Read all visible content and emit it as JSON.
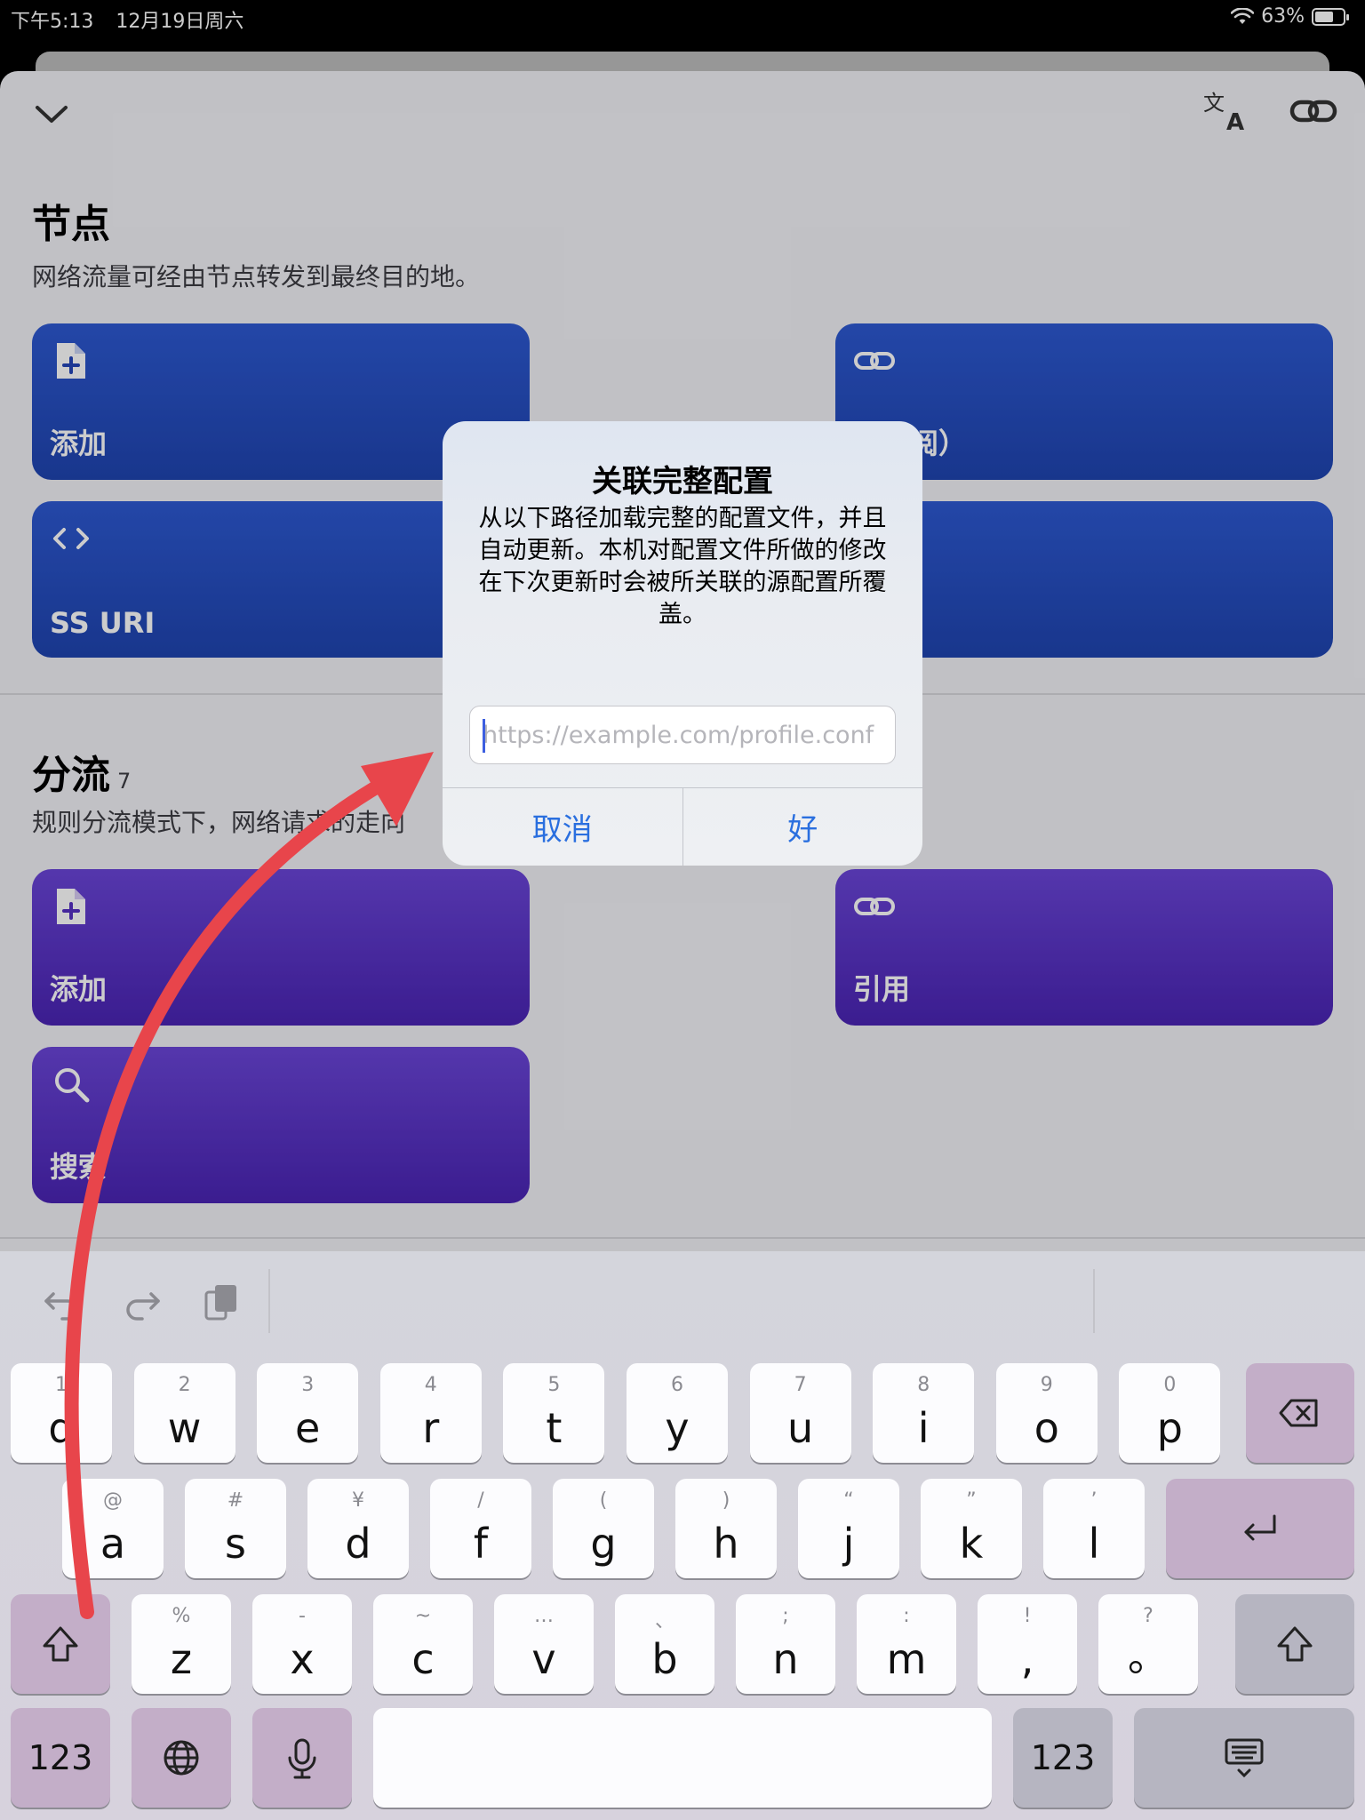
{
  "status_bar": {
    "time": "下午5:13",
    "date": "12月19日周六",
    "battery": "63%"
  },
  "nodes": {
    "title": "节点",
    "subtitle": "网络流量可经由节点转发到最终目的地。",
    "cards": [
      {
        "label": "添加",
        "icon": "file-plus-icon"
      },
      {
        "label": "（订阅）",
        "icon": "link-icon"
      },
      {
        "label": "SS URI",
        "icon": "code-icon"
      }
    ]
  },
  "rules": {
    "title": "分流",
    "count": "7",
    "subtitle": "规则分流模式下，网络请求的走向",
    "cards": [
      {
        "label": "添加",
        "icon": "file-plus-icon"
      },
      {
        "label": "引用",
        "icon": "link-icon"
      },
      {
        "label": "搜索",
        "icon": "search-icon"
      }
    ]
  },
  "alert": {
    "title": "关联完整配置",
    "message": "从以下路径加载完整的配置文件，并且自动更新。本机对配置文件所做的修改在下次更新时会被所关联的源配置所覆盖。",
    "placeholder": "https://example.com/profile.conf",
    "cancel": "取消",
    "ok": "好"
  },
  "keyboard": {
    "row1": [
      {
        "hint": "1",
        "key": "q"
      },
      {
        "hint": "2",
        "key": "w"
      },
      {
        "hint": "3",
        "key": "e"
      },
      {
        "hint": "4",
        "key": "r"
      },
      {
        "hint": "5",
        "key": "t"
      },
      {
        "hint": "6",
        "key": "y"
      },
      {
        "hint": "7",
        "key": "u"
      },
      {
        "hint": "8",
        "key": "i"
      },
      {
        "hint": "9",
        "key": "o"
      },
      {
        "hint": "0",
        "key": "p"
      }
    ],
    "row2": [
      {
        "hint": "@",
        "key": "a"
      },
      {
        "hint": "#",
        "key": "s"
      },
      {
        "hint": "¥",
        "key": "d"
      },
      {
        "hint": "/",
        "key": "f"
      },
      {
        "hint": "(",
        "key": "g"
      },
      {
        "hint": ")",
        "key": "h"
      },
      {
        "hint": "“",
        "key": "j"
      },
      {
        "hint": "”",
        "key": "k"
      },
      {
        "hint": "’",
        "key": "l"
      }
    ],
    "row3": [
      {
        "hint": "%",
        "key": "z"
      },
      {
        "hint": "-",
        "key": "x"
      },
      {
        "hint": "~",
        "key": "c"
      },
      {
        "hint": "…",
        "key": "v"
      },
      {
        "hint": "、",
        "key": "b"
      },
      {
        "hint": ";",
        "key": "n"
      },
      {
        "hint": ":",
        "key": "m"
      },
      {
        "hint": "!",
        "key": ","
      },
      {
        "hint": "?",
        "key": "。"
      }
    ],
    "numbers_label": "123",
    "numbers_label_right": "123"
  },
  "colors": {
    "blue_card": "#2445b8",
    "purple_card": "#5530c4",
    "alert_button": "#2a6fdf",
    "annotation_arrow": "#e8454b"
  }
}
